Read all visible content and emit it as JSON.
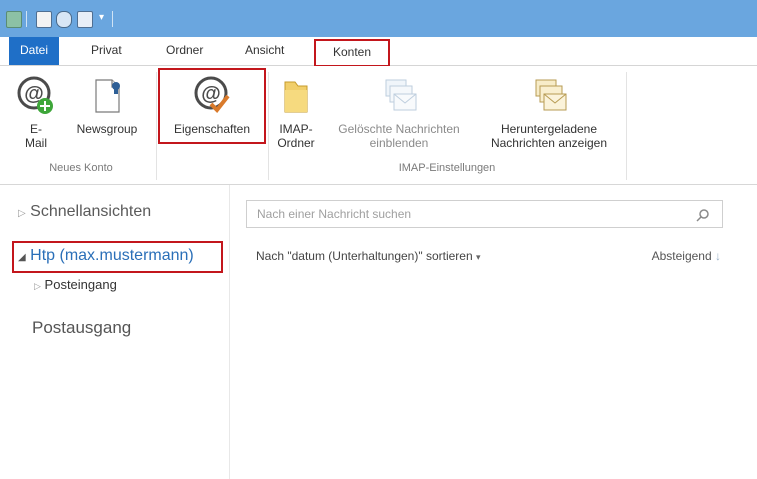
{
  "ribbon_tabs": {
    "file": "Datei",
    "private": "Privat",
    "folder": "Ordner",
    "view": "Ansicht",
    "accounts": "Konten"
  },
  "ribbon": {
    "email_line1": "E-",
    "email_line2": "Mail",
    "newsgroup": "Newsgroup",
    "new_account_group": "Neues Konto",
    "properties": "Eigenschaften",
    "imap_folder_line1": "IMAP-",
    "imap_folder_line2": "Ordner",
    "show_deleted_line1": "Gelöschte Nachrichten",
    "show_deleted_line2": "einblenden",
    "show_downloaded_line1": "Heruntergeladene",
    "show_downloaded_line2": "Nachrichten anzeigen",
    "imap_settings_group": "IMAP-Einstellungen"
  },
  "nav": {
    "quick_views": "Schnellansichten",
    "account": "Htp (max.mustermann)",
    "inbox": "Posteingang",
    "outbox": "Postausgang"
  },
  "message_list": {
    "search_placeholder": "Nach einer Nachricht suchen",
    "sort_label": "Nach \"datum (Unterhaltungen)\" sortieren",
    "order_label": "Absteigend"
  },
  "colors": {
    "title_bar": "#6aa6df",
    "file_tab": "#1f6fc7",
    "highlight": "#c3161c"
  }
}
